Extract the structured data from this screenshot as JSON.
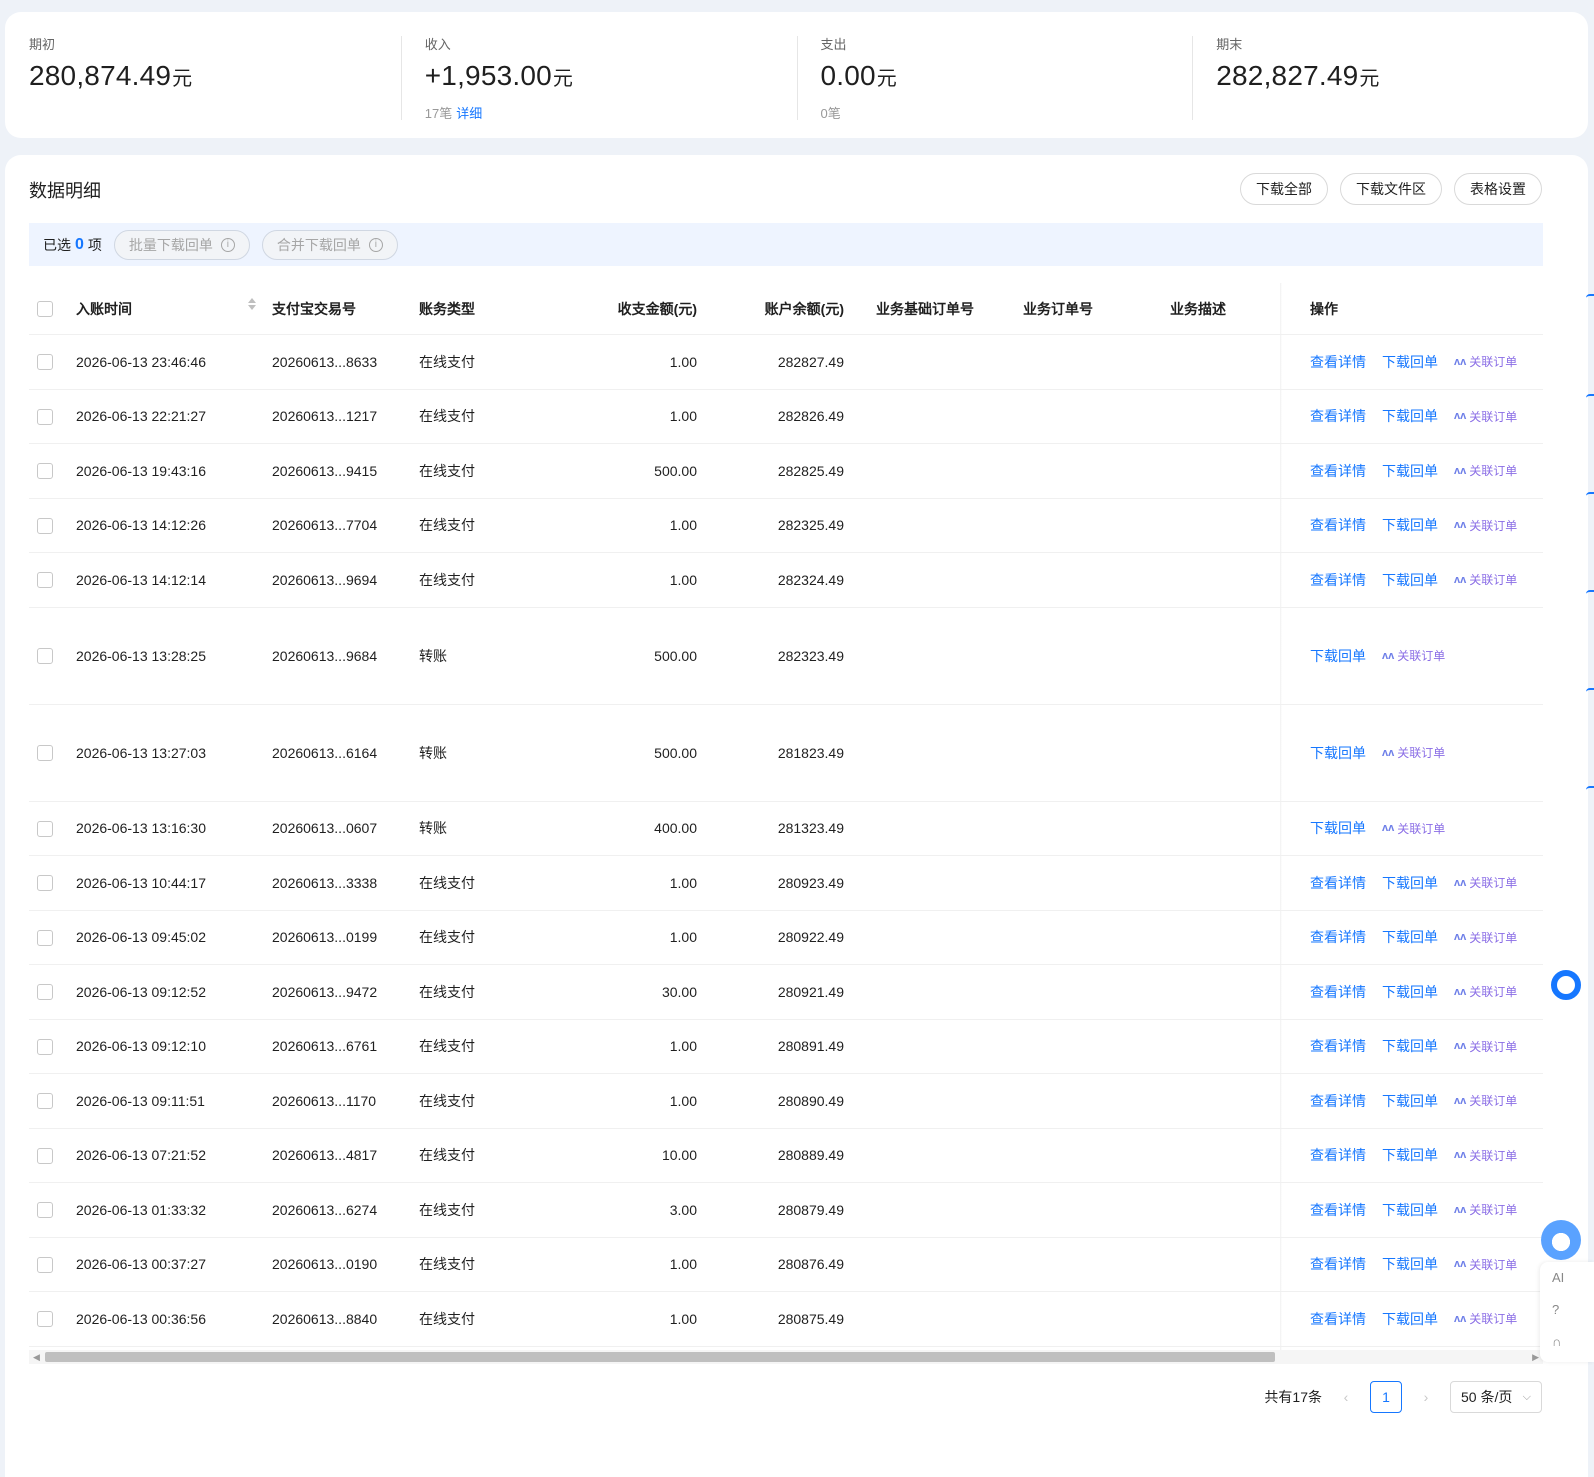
{
  "summary": [
    {
      "label": "期初",
      "value": "280,874.49",
      "unit": "元",
      "sub": "",
      "link": ""
    },
    {
      "label": "收入",
      "value": "+1,953.00",
      "unit": "元",
      "sub": "17笔",
      "link": "详细"
    },
    {
      "label": "支出",
      "value": "0.00",
      "unit": "元",
      "sub": "0笔",
      "link": ""
    },
    {
      "label": "期末",
      "value": "282,827.49",
      "unit": "元",
      "sub": "",
      "link": ""
    }
  ],
  "section": {
    "title": "数据明细",
    "download_all": "下载全部",
    "download_files": "下载文件区",
    "table_settings": "表格设置"
  },
  "selection": {
    "prefix": "已选",
    "count": "0",
    "suffix": "项",
    "batch_download": "批量下载回单",
    "merge_download": "合并下载回单"
  },
  "columns": {
    "time": "入账时间",
    "trade_no": "支付宝交易号",
    "type": "账务类型",
    "amount": "收支金额(元)",
    "balance": "账户余额(元)",
    "base_order": "业务基础订单号",
    "order": "业务订单号",
    "desc": "业务描述",
    "ops": "操作"
  },
  "ops": {
    "view": "查看详情",
    "download": "下载回单",
    "link_order": "关联订单"
  },
  "rows": [
    {
      "time": "2026-06-13 23:46:46",
      "trade": "20260613...8633",
      "type": "在线支付",
      "amount": "1.00",
      "balance": "282827.49",
      "tall": false
    },
    {
      "time": "2026-06-13 22:21:27",
      "trade": "20260613...1217",
      "type": "在线支付",
      "amount": "1.00",
      "balance": "282826.49",
      "tall": false
    },
    {
      "time": "2026-06-13 19:43:16",
      "trade": "20260613...9415",
      "type": "在线支付",
      "amount": "500.00",
      "balance": "282825.49",
      "tall": false
    },
    {
      "time": "2026-06-13 14:12:26",
      "trade": "20260613...7704",
      "type": "在线支付",
      "amount": "1.00",
      "balance": "282325.49",
      "tall": false
    },
    {
      "time": "2026-06-13 14:12:14",
      "trade": "20260613...9694",
      "type": "在线支付",
      "amount": "1.00",
      "balance": "282324.49",
      "tall": false
    },
    {
      "time": "2026-06-13 13:28:25",
      "trade": "20260613...9684",
      "type": "转账",
      "amount": "500.00",
      "balance": "282323.49",
      "tall": true
    },
    {
      "time": "2026-06-13 13:27:03",
      "trade": "20260613...6164",
      "type": "转账",
      "amount": "500.00",
      "balance": "281823.49",
      "tall": true
    },
    {
      "time": "2026-06-13 13:16:30",
      "trade": "20260613...0607",
      "type": "转账",
      "amount": "400.00",
      "balance": "281323.49",
      "tall": false
    },
    {
      "time": "2026-06-13 10:44:17",
      "trade": "20260613...3338",
      "type": "在线支付",
      "amount": "1.00",
      "balance": "280923.49",
      "tall": false
    },
    {
      "time": "2026-06-13 09:45:02",
      "trade": "20260613...0199",
      "type": "在线支付",
      "amount": "1.00",
      "balance": "280922.49",
      "tall": false
    },
    {
      "time": "2026-06-13 09:12:52",
      "trade": "20260613...9472",
      "type": "在线支付",
      "amount": "30.00",
      "balance": "280921.49",
      "tall": false
    },
    {
      "time": "2026-06-13 09:12:10",
      "trade": "20260613...6761",
      "type": "在线支付",
      "amount": "1.00",
      "balance": "280891.49",
      "tall": false
    },
    {
      "time": "2026-06-13 09:11:51",
      "trade": "20260613...1170",
      "type": "在线支付",
      "amount": "1.00",
      "balance": "280890.49",
      "tall": false
    },
    {
      "time": "2026-06-13 07:21:52",
      "trade": "20260613...4817",
      "type": "在线支付",
      "amount": "10.00",
      "balance": "280889.49",
      "tall": false
    },
    {
      "time": "2026-06-13 01:33:32",
      "trade": "20260613...6274",
      "type": "在线支付",
      "amount": "3.00",
      "balance": "280879.49",
      "tall": false
    },
    {
      "time": "2026-06-13 00:37:27",
      "trade": "20260613...0190",
      "type": "在线支付",
      "amount": "1.00",
      "balance": "280876.49",
      "tall": false
    },
    {
      "time": "2026-06-13 00:36:56",
      "trade": "20260613...8840",
      "type": "在线支付",
      "amount": "1.00",
      "balance": "280875.49",
      "tall": false
    }
  ],
  "pagination": {
    "total": "共有17条",
    "current": "1",
    "page_size": "50 条/页"
  },
  "side_tools": {
    "ai": "AI"
  },
  "colors": {
    "accent": "#1677ff",
    "ai_link": "#8b6ee6",
    "background": "#eef2f8"
  }
}
